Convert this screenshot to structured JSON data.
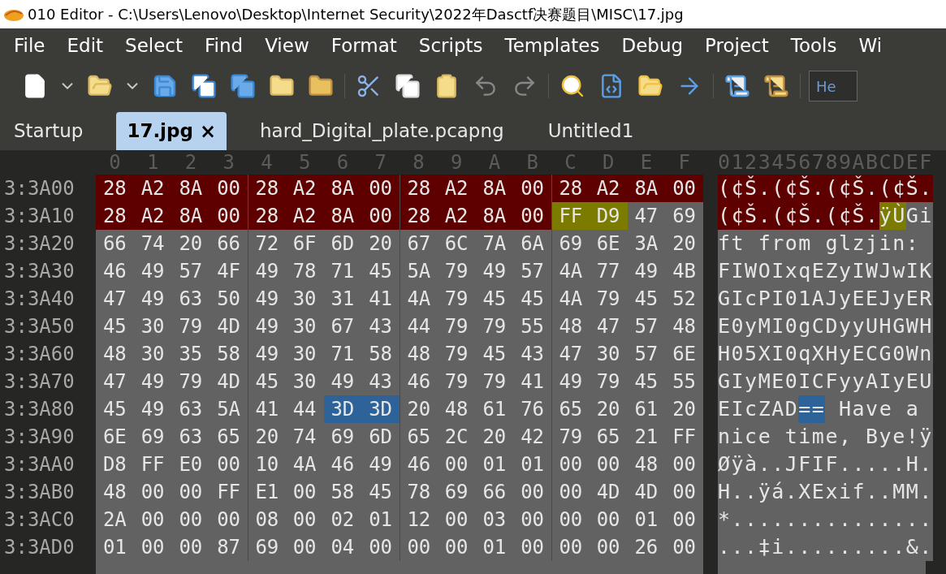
{
  "window": {
    "title": "010 Editor - C:\\Users\\Lenovo\\Desktop\\Internet Security\\2022年Dasctf决赛题目\\MISC\\17.jpg"
  },
  "menu": [
    "File",
    "Edit",
    "Select",
    "Find",
    "View",
    "Format",
    "Scripts",
    "Templates",
    "Debug",
    "Project",
    "Tools",
    "Wi"
  ],
  "toolbar": {
    "field_value": "He"
  },
  "tabs": [
    {
      "label": "Startup",
      "selected": false
    },
    {
      "label": "17.jpg",
      "selected": true,
      "close": "×"
    },
    {
      "label": "hard_Digital_plate.pcapng",
      "selected": false
    },
    {
      "label": "Untitled1",
      "selected": false
    }
  ],
  "hex_view": {
    "columns": [
      "0",
      "1",
      "2",
      "3",
      "4",
      "5",
      "6",
      "7",
      "8",
      "9",
      "A",
      "B",
      "C",
      "D",
      "E",
      "F"
    ],
    "text_header": "0123456789ABCDEF",
    "rows": [
      {
        "address": "3:3A00",
        "hex": [
          {
            "color": "#5e0000",
            "bytes": [
              "28",
              "A2",
              "8A",
              "00",
              "28",
              "A2",
              "8A",
              "00",
              "28",
              "A2",
              "8A",
              "00",
              "28",
              "A2",
              "8A",
              "00"
            ]
          }
        ],
        "text": [
          {
            "color": "#5e0000",
            "text": "(¢Š.(¢Š.(¢Š.(¢Š."
          }
        ]
      },
      {
        "address": "3:3A10",
        "hex": [
          {
            "color": "#5e0000",
            "bytes": [
              "28",
              "A2",
              "8A",
              "00",
              "28",
              "A2",
              "8A",
              "00",
              "28",
              "A2",
              "8A",
              "00"
            ]
          },
          {
            "color": "#7b7b00",
            "bytes": [
              "FF",
              "D9"
            ]
          },
          {
            "color": "#626262",
            "bytes": [
              "47",
              "69"
            ]
          }
        ],
        "text": [
          {
            "color": "#5e0000",
            "text": "(¢Š.(¢Š.(¢Š."
          },
          {
            "color": "#7b7b00",
            "text": "ÿÙ"
          },
          {
            "color": "#626262",
            "text": "Gi"
          }
        ]
      },
      {
        "address": "3:3A20",
        "hex": [
          {
            "color": "#626262",
            "bytes": [
              "66",
              "74",
              "20",
              "66",
              "72",
              "6F",
              "6D",
              "20",
              "67",
              "6C",
              "7A",
              "6A",
              "69",
              "6E",
              "3A",
              "20"
            ]
          }
        ],
        "text": [
          {
            "color": "#626262",
            "text": "ft from glzjin: "
          }
        ]
      },
      {
        "address": "3:3A30",
        "hex": [
          {
            "color": "#626262",
            "bytes": [
              "46",
              "49",
              "57",
              "4F",
              "49",
              "78",
              "71",
              "45",
              "5A",
              "79",
              "49",
              "57",
              "4A",
              "77",
              "49",
              "4B"
            ]
          }
        ],
        "text": [
          {
            "color": "#626262",
            "text": "FIWOIxqEZyIWJwIK"
          }
        ]
      },
      {
        "address": "3:3A40",
        "hex": [
          {
            "color": "#626262",
            "bytes": [
              "47",
              "49",
              "63",
              "50",
              "49",
              "30",
              "31",
              "41",
              "4A",
              "79",
              "45",
              "45",
              "4A",
              "79",
              "45",
              "52"
            ]
          }
        ],
        "text": [
          {
            "color": "#626262",
            "text": "GIcPI01AJyEEJyER"
          }
        ]
      },
      {
        "address": "3:3A50",
        "hex": [
          {
            "color": "#626262",
            "bytes": [
              "45",
              "30",
              "79",
              "4D",
              "49",
              "30",
              "67",
              "43",
              "44",
              "79",
              "79",
              "55",
              "48",
              "47",
              "57",
              "48"
            ]
          }
        ],
        "text": [
          {
            "color": "#626262",
            "text": "E0yMI0gCDyyUHGWH"
          }
        ]
      },
      {
        "address": "3:3A60",
        "hex": [
          {
            "color": "#626262",
            "bytes": [
              "48",
              "30",
              "35",
              "58",
              "49",
              "30",
              "71",
              "58",
              "48",
              "79",
              "45",
              "43",
              "47",
              "30",
              "57",
              "6E"
            ]
          }
        ],
        "text": [
          {
            "color": "#626262",
            "text": "H05XI0qXHyECG0Wn"
          }
        ]
      },
      {
        "address": "3:3A70",
        "hex": [
          {
            "color": "#626262",
            "bytes": [
              "47",
              "49",
              "79",
              "4D",
              "45",
              "30",
              "49",
              "43",
              "46",
              "79",
              "79",
              "41",
              "49",
              "79",
              "45",
              "55"
            ]
          }
        ],
        "text": [
          {
            "color": "#626262",
            "text": "GIyME0ICFyyAIyEU"
          }
        ]
      },
      {
        "address": "3:3A80",
        "hex": [
          {
            "color": "#626262",
            "bytes": [
              "45",
              "49",
              "63",
              "5A",
              "41",
              "44"
            ]
          },
          {
            "color": "#2d6399",
            "bytes": [
              "3D",
              "3D"
            ]
          },
          {
            "color": "#626262",
            "bytes": [
              "20",
              "48",
              "61",
              "76",
              "65",
              "20",
              "61",
              "20"
            ]
          }
        ],
        "text": [
          {
            "color": "#626262",
            "text": "EIcZAD"
          },
          {
            "color": "#2d6399",
            "text": "=="
          },
          {
            "color": "#626262",
            "text": " Have a "
          }
        ]
      },
      {
        "address": "3:3A90",
        "hex": [
          {
            "color": "#626262",
            "bytes": [
              "6E",
              "69",
              "63",
              "65",
              "20",
              "74",
              "69",
              "6D",
              "65",
              "2C",
              "20",
              "42",
              "79",
              "65",
              "21",
              "FF"
            ]
          }
        ],
        "text": [
          {
            "color": "#626262",
            "text": "nice time, Bye!ÿ"
          }
        ]
      },
      {
        "address": "3:3AA0",
        "hex": [
          {
            "color": "#626262",
            "bytes": [
              "D8",
              "FF",
              "E0",
              "00",
              "10",
              "4A",
              "46",
              "49",
              "46",
              "00",
              "01",
              "01",
              "00",
              "00",
              "48",
              "00"
            ]
          }
        ],
        "text": [
          {
            "color": "#626262",
            "text": "Øÿà..JFIF.....H."
          }
        ]
      },
      {
        "address": "3:3AB0",
        "hex": [
          {
            "color": "#626262",
            "bytes": [
              "48",
              "00",
              "00",
              "FF",
              "E1",
              "00",
              "58",
              "45",
              "78",
              "69",
              "66",
              "00",
              "00",
              "4D",
              "4D",
              "00"
            ]
          }
        ],
        "text": [
          {
            "color": "#626262",
            "text": "H..ÿá.XExif..MM."
          }
        ]
      },
      {
        "address": "3:3AC0",
        "hex": [
          {
            "color": "#626262",
            "bytes": [
              "2A",
              "00",
              "00",
              "00",
              "08",
              "00",
              "02",
              "01",
              "12",
              "00",
              "03",
              "00",
              "00",
              "00",
              "01",
              "00"
            ]
          }
        ],
        "text": [
          {
            "color": "#626262",
            "text": "*..............."
          }
        ]
      },
      {
        "address": "3:3AD0",
        "hex": [
          {
            "color": "#626262",
            "bytes": [
              "01",
              "00",
              "00",
              "87",
              "69",
              "00",
              "04",
              "00",
              "00",
              "00",
              "01",
              "00",
              "00",
              "00",
              "26",
              "00"
            ]
          }
        ],
        "text": [
          {
            "color": "#626262",
            "text": "...‡i.........&."
          }
        ]
      }
    ]
  }
}
